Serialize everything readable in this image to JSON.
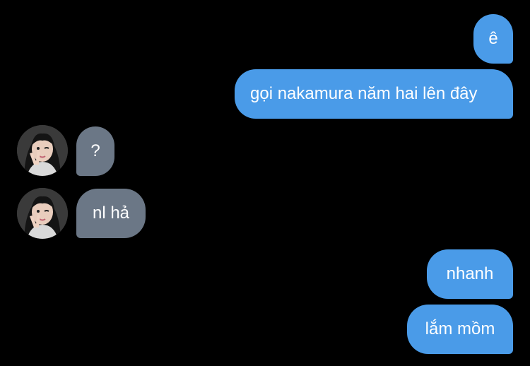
{
  "colors": {
    "background": "#000000",
    "outgoing_bubble": "#4a9be8",
    "incoming_bubble": "#6b7786",
    "bubble_text": "#ffffff"
  },
  "messages": [
    {
      "side": "outgoing",
      "text": "ê"
    },
    {
      "side": "outgoing",
      "text": "gọi nakamura năm hai lên đây"
    },
    {
      "side": "incoming",
      "text": "?"
    },
    {
      "side": "incoming",
      "text": "nl hả"
    },
    {
      "side": "outgoing",
      "text": "nhanh"
    },
    {
      "side": "outgoing",
      "text": "lắm mồm"
    }
  ],
  "avatar_icon": "contact-photo-icon"
}
